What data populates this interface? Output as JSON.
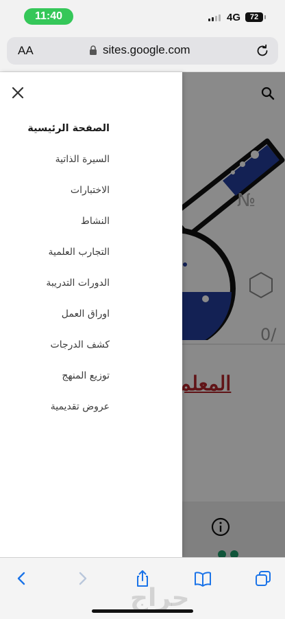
{
  "status_bar": {
    "time": "11:40",
    "network": "4G",
    "battery": "72"
  },
  "browser": {
    "text_size_label": "AA",
    "url": "sites.google.com"
  },
  "drawer": {
    "nav_items": [
      {
        "label": "الصفحة الرئيسية",
        "active": true
      },
      {
        "label": "السيرة الذاتية"
      },
      {
        "label": "الاختبارات"
      },
      {
        "label": "النشاط"
      },
      {
        "label": "التجارب العلمية"
      },
      {
        "label": "الدورات التدريبة"
      },
      {
        "label": "اوراق العمل"
      },
      {
        "label": "كشف الدرجات"
      },
      {
        "label": "توزيع المنهج"
      },
      {
        "label": "عروض تقديمية"
      }
    ]
  },
  "page": {
    "teacher_title": "المعلم :",
    "numero_symbol": "№",
    "fraction_symbol": "0/"
  },
  "watermark": "حراج",
  "colors": {
    "status_green": "#35c759",
    "ios_blue": "#1a73e8",
    "title_red": "#b3262c",
    "flask_blue": "#233d9b"
  },
  "icons": [
    "close-icon",
    "search-icon",
    "lock-icon",
    "reload-icon",
    "back-icon",
    "forward-icon",
    "share-icon",
    "bookmarks-icon",
    "tabs-icon",
    "info-icon"
  ]
}
